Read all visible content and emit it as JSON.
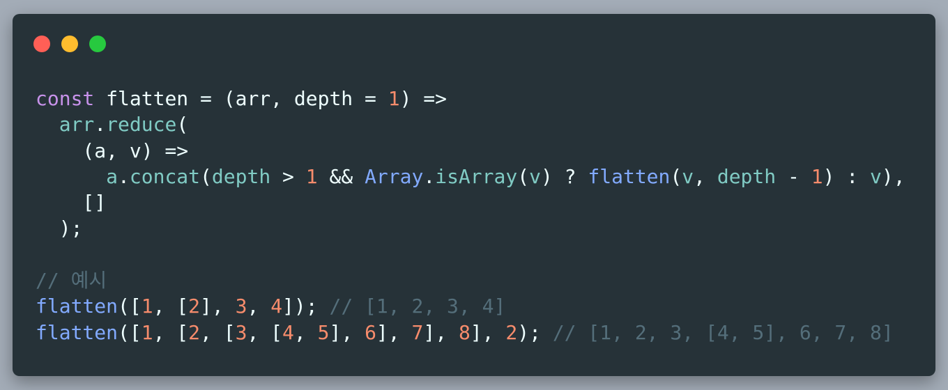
{
  "window": {
    "controls": {
      "close_color": "#ff5f56",
      "minimize_color": "#ffbd2e",
      "maximize_color": "#27c93f"
    }
  },
  "theme": {
    "background": "#263238",
    "keyword": "#c792ea",
    "number": "#f78c6c",
    "function": "#82aaff",
    "variable": "#80cbc4",
    "comment": "#546e7a",
    "text": "#eeffff"
  },
  "code": {
    "lines": [
      [
        {
          "t": "const",
          "c": "kw"
        },
        {
          "t": " flatten = (arr, depth = ",
          "c": "pl"
        },
        {
          "t": "1",
          "c": "num"
        },
        {
          "t": ") =>",
          "c": "pl"
        }
      ],
      [
        {
          "t": "  ",
          "c": "pl"
        },
        {
          "t": "arr",
          "c": "var"
        },
        {
          "t": ".",
          "c": "pl"
        },
        {
          "t": "reduce",
          "c": "var"
        },
        {
          "t": "(",
          "c": "pl"
        }
      ],
      [
        {
          "t": "    (a, v) =>",
          "c": "pl"
        }
      ],
      [
        {
          "t": "      ",
          "c": "pl"
        },
        {
          "t": "a",
          "c": "var"
        },
        {
          "t": ".",
          "c": "pl"
        },
        {
          "t": "concat",
          "c": "var"
        },
        {
          "t": "(",
          "c": "pl"
        },
        {
          "t": "depth",
          "c": "var"
        },
        {
          "t": " > ",
          "c": "pl"
        },
        {
          "t": "1",
          "c": "num"
        },
        {
          "t": " && ",
          "c": "pl"
        },
        {
          "t": "Array",
          "c": "fn"
        },
        {
          "t": ".",
          "c": "pl"
        },
        {
          "t": "isArray",
          "c": "var"
        },
        {
          "t": "(",
          "c": "pl"
        },
        {
          "t": "v",
          "c": "var"
        },
        {
          "t": ") ? ",
          "c": "pl"
        },
        {
          "t": "flatten",
          "c": "fn"
        },
        {
          "t": "(",
          "c": "pl"
        },
        {
          "t": "v",
          "c": "var"
        },
        {
          "t": ", ",
          "c": "pl"
        },
        {
          "t": "depth",
          "c": "var"
        },
        {
          "t": " - ",
          "c": "pl"
        },
        {
          "t": "1",
          "c": "num"
        },
        {
          "t": ") : ",
          "c": "pl"
        },
        {
          "t": "v",
          "c": "var"
        },
        {
          "t": "),",
          "c": "pl"
        }
      ],
      [
        {
          "t": "    []",
          "c": "pl"
        }
      ],
      [
        {
          "t": "  );",
          "c": "pl"
        }
      ],
      [
        {
          "t": "",
          "c": "pl"
        }
      ],
      [
        {
          "t": "// 예시",
          "c": "cm"
        }
      ],
      [
        {
          "t": "flatten",
          "c": "fn"
        },
        {
          "t": "([",
          "c": "pl"
        },
        {
          "t": "1",
          "c": "num"
        },
        {
          "t": ", [",
          "c": "pl"
        },
        {
          "t": "2",
          "c": "num"
        },
        {
          "t": "], ",
          "c": "pl"
        },
        {
          "t": "3",
          "c": "num"
        },
        {
          "t": ", ",
          "c": "pl"
        },
        {
          "t": "4",
          "c": "num"
        },
        {
          "t": "]); ",
          "c": "pl"
        },
        {
          "t": "// [1, 2, 3, 4]",
          "c": "cm"
        }
      ],
      [
        {
          "t": "flatten",
          "c": "fn"
        },
        {
          "t": "([",
          "c": "pl"
        },
        {
          "t": "1",
          "c": "num"
        },
        {
          "t": ", [",
          "c": "pl"
        },
        {
          "t": "2",
          "c": "num"
        },
        {
          "t": ", [",
          "c": "pl"
        },
        {
          "t": "3",
          "c": "num"
        },
        {
          "t": ", [",
          "c": "pl"
        },
        {
          "t": "4",
          "c": "num"
        },
        {
          "t": ", ",
          "c": "pl"
        },
        {
          "t": "5",
          "c": "num"
        },
        {
          "t": "], ",
          "c": "pl"
        },
        {
          "t": "6",
          "c": "num"
        },
        {
          "t": "], ",
          "c": "pl"
        },
        {
          "t": "7",
          "c": "num"
        },
        {
          "t": "], ",
          "c": "pl"
        },
        {
          "t": "8",
          "c": "num"
        },
        {
          "t": "], ",
          "c": "pl"
        },
        {
          "t": "2",
          "c": "num"
        },
        {
          "t": "); ",
          "c": "pl"
        },
        {
          "t": "// [1, 2, 3, [4, 5], 6, 7, 8]",
          "c": "cm"
        }
      ]
    ]
  }
}
